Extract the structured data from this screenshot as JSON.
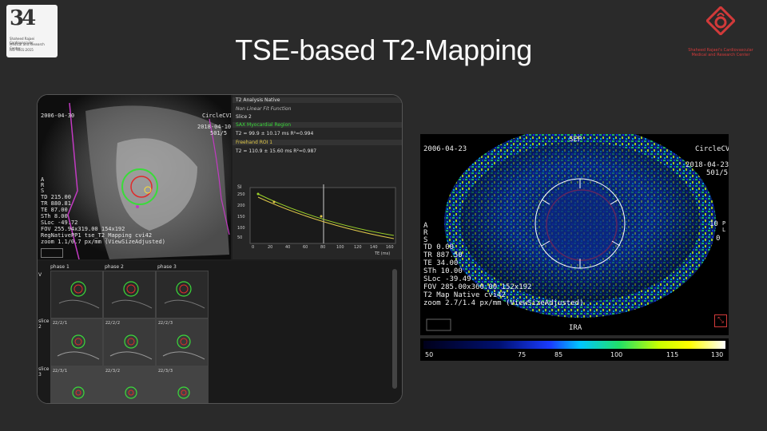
{
  "slide": {
    "title": "TSE-based T2-Mapping"
  },
  "logo_left": {
    "number": "34",
    "lines": [
      "Shaheed Rajaei Cardiovascular",
      "Medical and Research Center",
      "ISO 9001:2015"
    ]
  },
  "logo_right": {
    "line1": "Shaheed Rajaei's Cardiovascular",
    "line2": "Medical and Research Center"
  },
  "left_image": {
    "date": "2006-04-30",
    "vendor": "CircleCVI",
    "series_date": "2018-04-10",
    "series_id": "501/5",
    "orient": [
      "A",
      "R",
      "S"
    ],
    "params": [
      "TD 215.00",
      "TR 880.81",
      "TE 87.00",
      "STh 8.00",
      "SLoc -49.72",
      "FOV 255.94x319.00 154x192",
      "RegNativePP1 tse_T2_Mapping cvi42",
      "zoom 1.1/0.7 px/mm (ViewSizeAdjusted)"
    ]
  },
  "analysis": {
    "header": "T2 Analysis Native",
    "fit": "Non Linear Fit Function",
    "slice": "Slice 2",
    "region1": "SAX Myocardial Region",
    "region1_value": "T2 = 99.9 ± 10.17 ms R²=0.994",
    "region2": "Freehand ROI 1",
    "region2_value": "T2 = 110.9 ± 15.60 ms R²=0.987",
    "ylabel": "SI",
    "xlabel": "TE (ms)",
    "yticks": [
      "250",
      "200",
      "150",
      "100",
      "50"
    ],
    "xticks": [
      "0",
      "20",
      "40",
      "60",
      "80",
      "100",
      "120",
      "140",
      "160"
    ]
  },
  "grid": {
    "columns": [
      "phase 1",
      "phase 2",
      "phase 3"
    ],
    "rows": [
      {
        "label": "V",
        "cells": [
          "",
          "",
          ""
        ]
      },
      {
        "label": "slice 2",
        "cells": [
          "22/2/1",
          "22/2/2",
          "22/2/3"
        ]
      },
      {
        "label": "slice 3",
        "cells": [
          "22/3/1",
          "22/3/2",
          "22/3/3"
        ]
      }
    ]
  },
  "right_image": {
    "date": "2006-04-23",
    "top_label": "SEP",
    "vendor": "CircleCVI",
    "series_date": "2018-04-23",
    "series_id": "501/5",
    "orient": [
      "A",
      "R",
      "S"
    ],
    "side_values": [
      "10",
      "0"
    ],
    "side_letters": "P\nL",
    "params": [
      "TD 0.00",
      "TR 887.50",
      "TE 34.00",
      "STh 10.00",
      "SLoc -39.49",
      "FOV 285.00x360.00 152x192",
      "T2 Map Native cvi42",
      "zoom 2.7/1.4 px/mm (ViewSizeAdjusted)"
    ],
    "bottom_label": "IRA"
  },
  "colorbar": {
    "ticks": [
      "50",
      "75",
      "85",
      "100",
      "115",
      "130"
    ],
    "min": 50,
    "max": 130
  }
}
